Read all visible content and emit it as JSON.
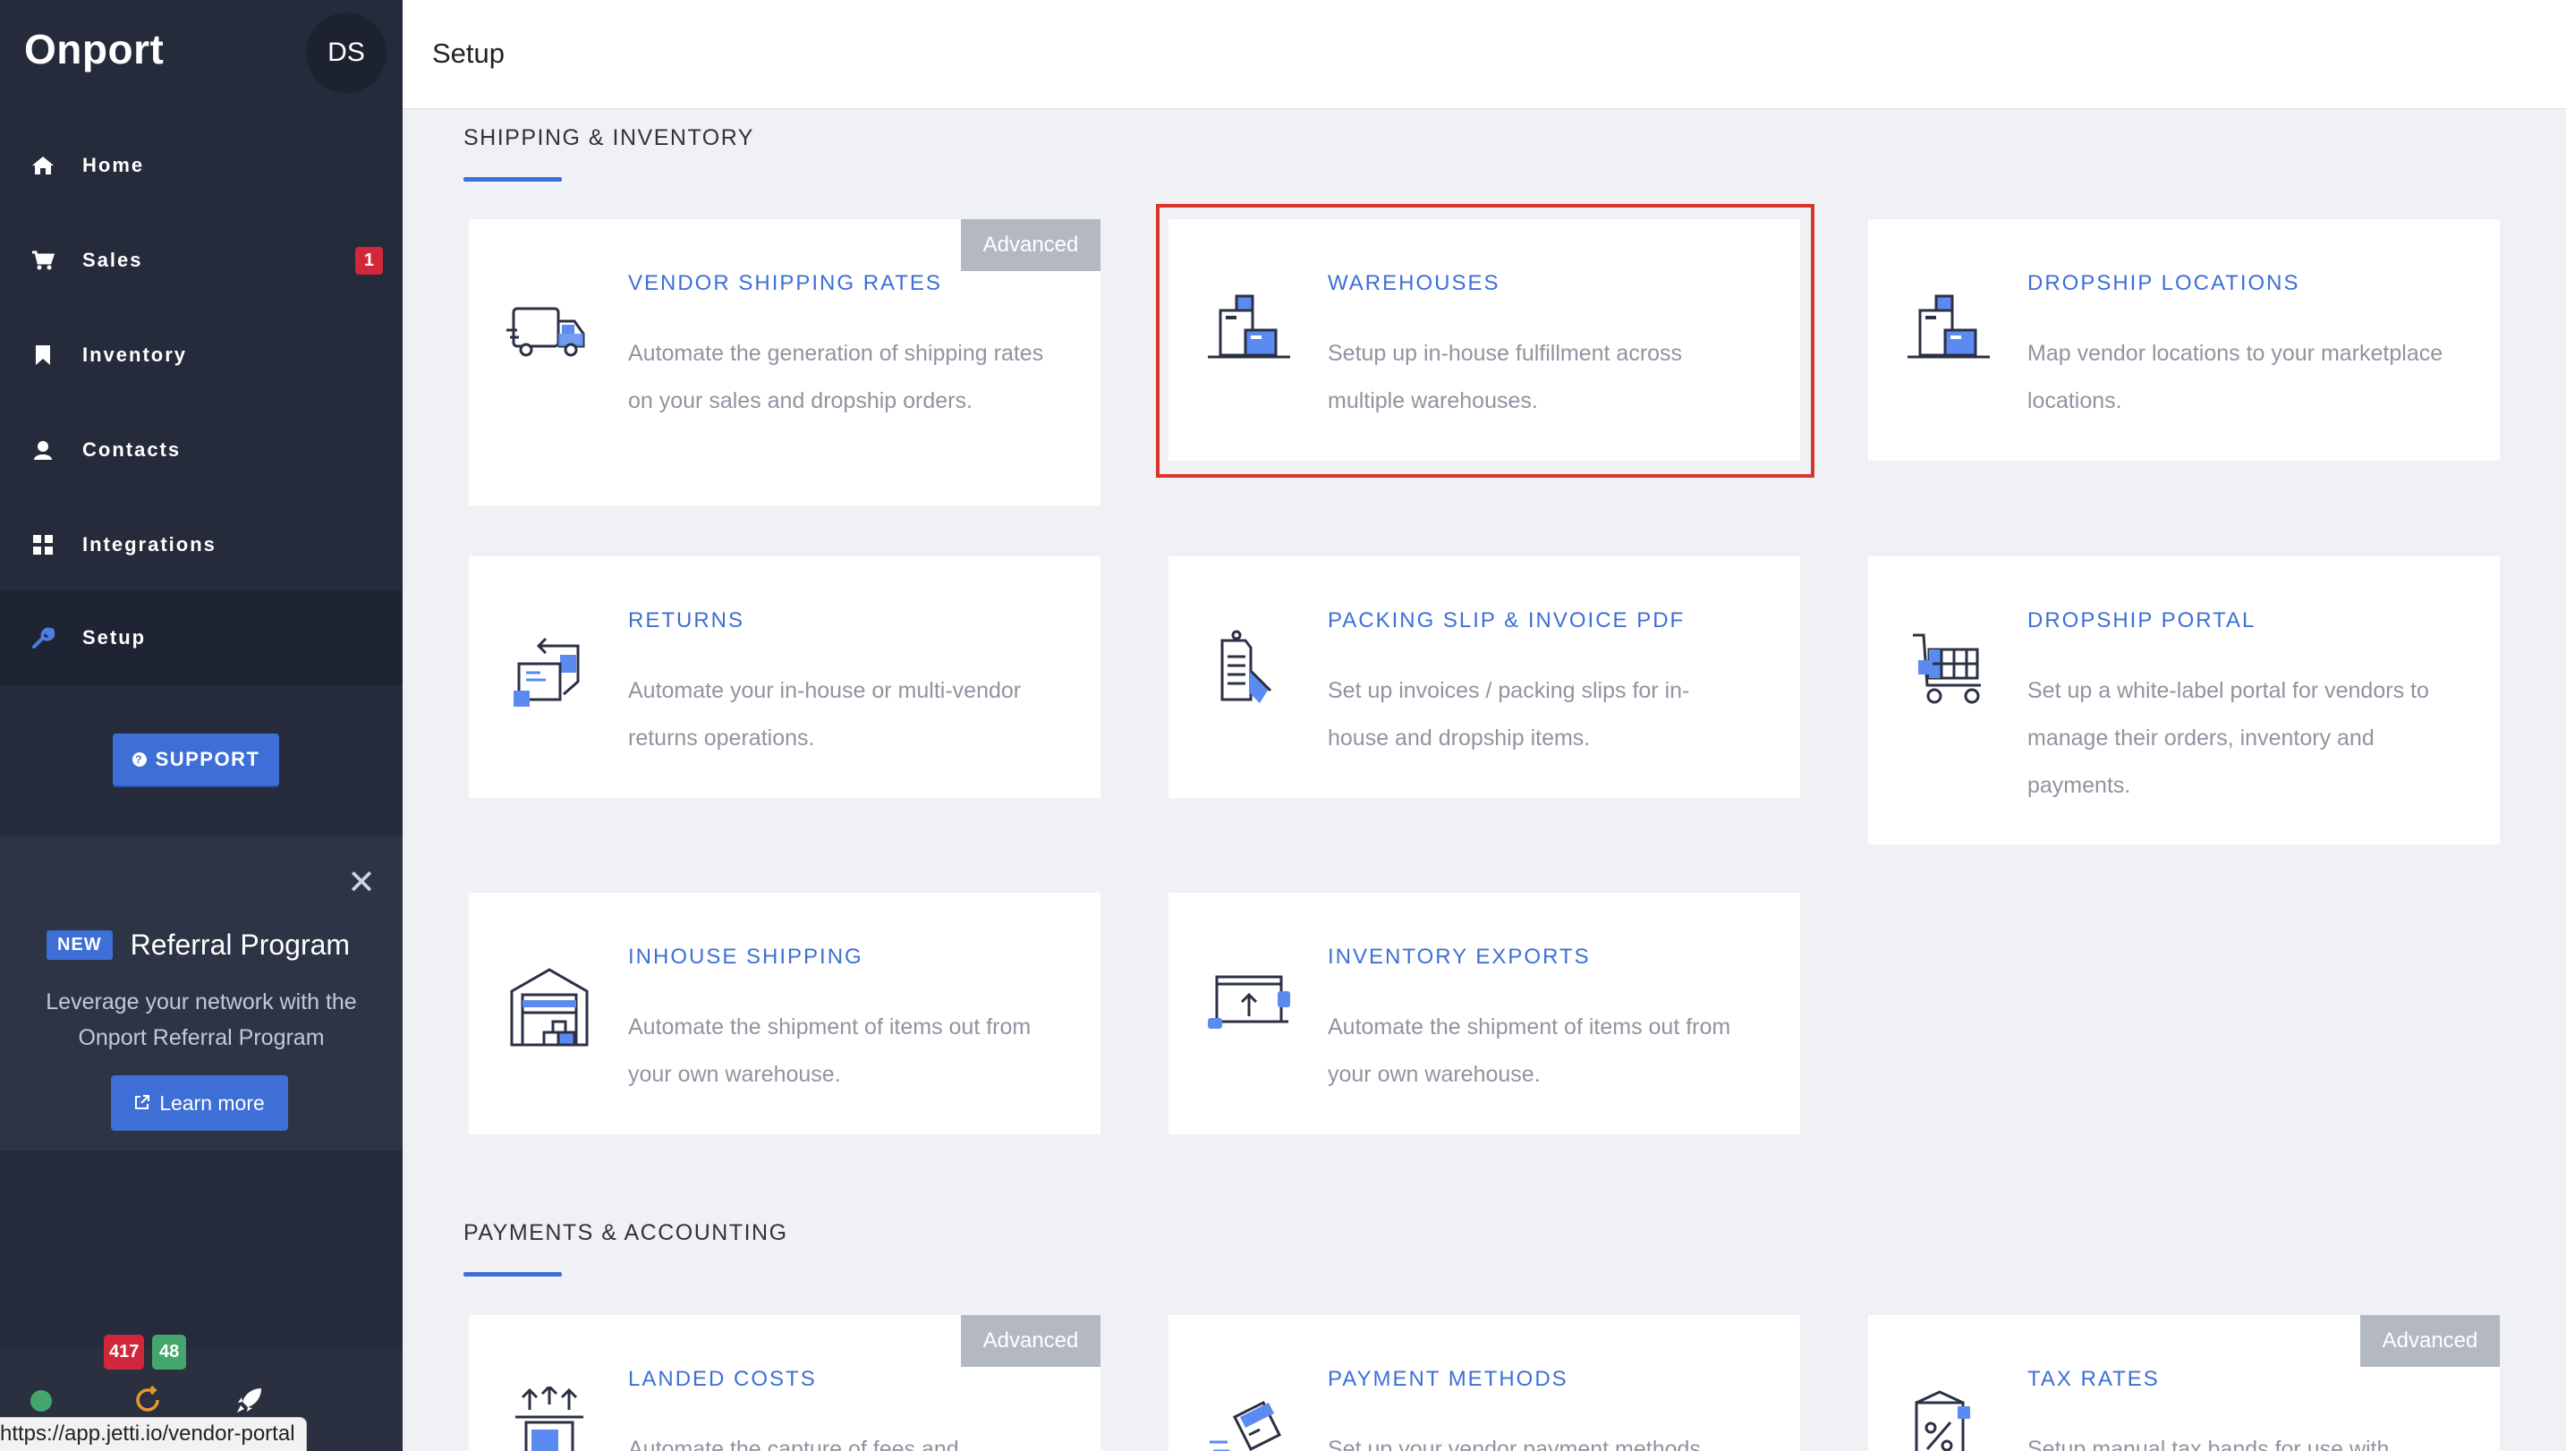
{
  "app": {
    "brand": "Onport",
    "avatar_initials": "DS",
    "page_title": "Setup"
  },
  "sidebar": {
    "items": [
      {
        "label": "Home",
        "icon": "home-icon"
      },
      {
        "label": "Sales",
        "icon": "cart-icon",
        "badge": "1"
      },
      {
        "label": "Inventory",
        "icon": "bookmark-icon"
      },
      {
        "label": "Contacts",
        "icon": "user-icon"
      },
      {
        "label": "Integrations",
        "icon": "grid-icon"
      },
      {
        "label": "Setup",
        "icon": "wrench-icon"
      }
    ],
    "support_label": "SUPPORT",
    "promo": {
      "badge": "NEW",
      "title": "Referral Program",
      "text": "Leverage your network with the Onport Referral Program",
      "button": "Learn more"
    },
    "footer": {
      "count_red": "417",
      "count_green": "48"
    },
    "url_tooltip": "https://app.jetti.io/vendor-portal"
  },
  "sections": [
    {
      "title": "SHIPPING & INVENTORY",
      "cards": [
        {
          "title": "VENDOR SHIPPING RATES",
          "desc": "Automate the generation of shipping rates on your sales and dropship orders.",
          "badge": "Advanced",
          "icon": "truck-icon"
        },
        {
          "title": "WAREHOUSES",
          "desc": "Setup up in-house fulfillment across multiple warehouses.",
          "icon": "warehouse-boxes-icon"
        },
        {
          "title": "DROPSHIP LOCATIONS",
          "desc": "Map vendor locations to your marketplace locations.",
          "icon": "dropship-boxes-icon"
        },
        {
          "title": "RETURNS",
          "desc": "Automate your in-house or multi-vendor returns operations.",
          "icon": "returns-icon"
        },
        {
          "title": "PACKING SLIP & INVOICE PDF",
          "desc": "Set up invoices / packing slips for in-house and dropship items.",
          "icon": "packing-slip-icon"
        },
        {
          "title": "DROPSHIP PORTAL",
          "desc": "Set up a white-label portal for vendors to manage their orders, inventory and payments.",
          "icon": "portal-cart-icon"
        },
        {
          "title": "INHOUSE SHIPPING",
          "desc": "Automate the shipment of items out from your own warehouse.",
          "icon": "garage-icon"
        },
        {
          "title": "INVENTORY EXPORTS",
          "desc": "Automate the shipment of items out from your own warehouse.",
          "icon": "export-laptop-icon"
        }
      ]
    },
    {
      "title": "PAYMENTS & ACCOUNTING",
      "cards": [
        {
          "title": "LANDED COSTS",
          "desc": "Automate the capture of fees and",
          "badge": "Advanced",
          "icon": "landed-costs-icon"
        },
        {
          "title": "PAYMENT METHODS",
          "desc": "Set up your vendor payment methods",
          "icon": "credit-card-icon"
        },
        {
          "title": "TAX RATES",
          "desc": "Setup manual tax bands for use with",
          "badge": "Advanced",
          "icon": "tax-document-icon"
        }
      ]
    }
  ]
}
